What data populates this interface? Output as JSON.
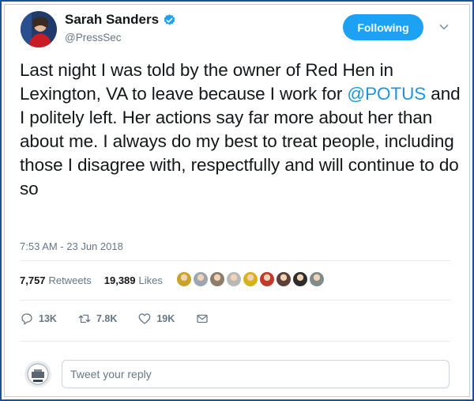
{
  "author": {
    "name": "Sarah Sanders",
    "handle": "@PressSec",
    "verified": true
  },
  "follow_button": {
    "label": "Following"
  },
  "tweet": {
    "text_before_mention": "Last night I was told by the owner of Red Hen in Lexington, VA to leave because I work for ",
    "mention": "@POTUS",
    "text_after_mention": " and I politely left. Her actions say far more about her than about me. I always do my best to treat people, including those I disagree with, respectfully and will continue to do so",
    "timestamp": "7:53 AM - 23 Jun 2018"
  },
  "stats": {
    "retweets_count": "7,757",
    "retweets_label": "Retweets",
    "likes_count": "19,389",
    "likes_label": "Likes"
  },
  "liker_avatars": [
    "#c9a227",
    "#9aa6b2",
    "#8a7d6b",
    "#b8b8b8",
    "#d6b21c",
    "#c0392b",
    "#5d4037",
    "#2c2c2c",
    "#7f8c8d"
  ],
  "actions": {
    "reply_count": "13K",
    "retweet_count": "7.8K",
    "like_count": "19K"
  },
  "reply": {
    "placeholder": "Tweet your reply"
  },
  "colors": {
    "accent": "#1da1f2",
    "link": "#1b95e0",
    "muted": "#657786"
  }
}
